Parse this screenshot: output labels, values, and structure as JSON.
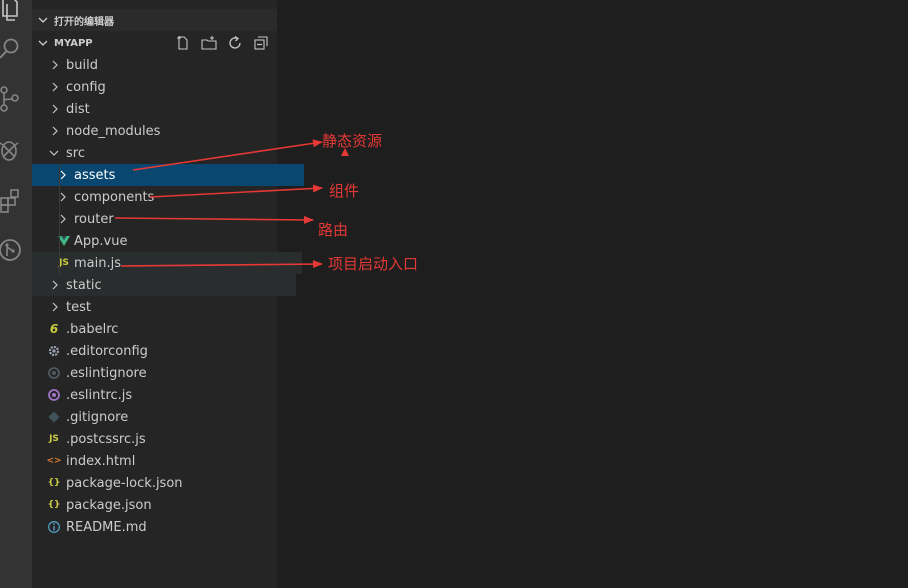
{
  "sidebar": {
    "open_editors_label": "打开的编辑器",
    "root_label": "MYAPP",
    "actions": [
      {
        "icon": "new-file-icon"
      },
      {
        "icon": "new-folder-icon"
      },
      {
        "icon": "refresh-icon"
      },
      {
        "icon": "collapse-all-icon"
      }
    ]
  },
  "activity_bar": {
    "items": [
      {
        "icon": "explorer-icon"
      },
      {
        "icon": "search-icon"
      },
      {
        "icon": "source-control-icon"
      },
      {
        "icon": "debug-icon"
      },
      {
        "icon": "extensions-icon"
      },
      {
        "icon": "git-graph-icon"
      }
    ]
  },
  "tree": {
    "build": "build",
    "config": "config",
    "dist": "dist",
    "node_modules": "node_modules",
    "src": "src",
    "assets": "assets",
    "components": "components",
    "router": "router",
    "app_vue": "App.vue",
    "main_js": "main.js",
    "static": "static",
    "test": "test",
    "babelrc": ".babelrc",
    "editorconfig": ".editorconfig",
    "eslintignore": ".eslintignore",
    "eslintrc": ".eslintrc.js",
    "gitignore": ".gitignore",
    "postcssrc": ".postcssrc.js",
    "index_html": "index.html",
    "package_lock": "package-lock.json",
    "package_json": "package.json",
    "readme": "README.md"
  },
  "file_icons": {
    "js": "JS",
    "json": "{}",
    "html": "<>",
    "babel": "6"
  },
  "annotations": {
    "assets_note": "静态资源",
    "components_note": "组件",
    "router_note": "路由",
    "main_note": "项目启动入口"
  },
  "colors": {
    "sidebar_bg": "#252526",
    "editor_bg": "#1e1e1e",
    "activity_bg": "#333333",
    "selection": "#094771",
    "annotation_red": "#e53935",
    "vue_green": "#41b883",
    "js_yellow": "#cbcb41",
    "html_orange": "#e37933",
    "eslint_purple": "#a074c4",
    "info_blue": "#519aba"
  }
}
